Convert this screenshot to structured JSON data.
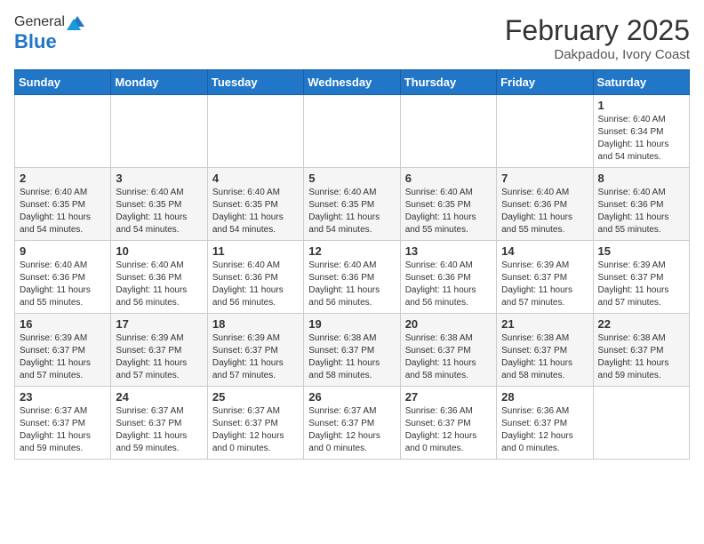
{
  "header": {
    "logo_general": "General",
    "logo_blue": "Blue",
    "month_title": "February 2025",
    "location": "Dakpadou, Ivory Coast"
  },
  "weekdays": [
    "Sunday",
    "Monday",
    "Tuesday",
    "Wednesday",
    "Thursday",
    "Friday",
    "Saturday"
  ],
  "weeks": [
    [
      {
        "day": "",
        "info": ""
      },
      {
        "day": "",
        "info": ""
      },
      {
        "day": "",
        "info": ""
      },
      {
        "day": "",
        "info": ""
      },
      {
        "day": "",
        "info": ""
      },
      {
        "day": "",
        "info": ""
      },
      {
        "day": "1",
        "info": "Sunrise: 6:40 AM\nSunset: 6:34 PM\nDaylight: 11 hours\nand 54 minutes."
      }
    ],
    [
      {
        "day": "2",
        "info": "Sunrise: 6:40 AM\nSunset: 6:35 PM\nDaylight: 11 hours\nand 54 minutes."
      },
      {
        "day": "3",
        "info": "Sunrise: 6:40 AM\nSunset: 6:35 PM\nDaylight: 11 hours\nand 54 minutes."
      },
      {
        "day": "4",
        "info": "Sunrise: 6:40 AM\nSunset: 6:35 PM\nDaylight: 11 hours\nand 54 minutes."
      },
      {
        "day": "5",
        "info": "Sunrise: 6:40 AM\nSunset: 6:35 PM\nDaylight: 11 hours\nand 54 minutes."
      },
      {
        "day": "6",
        "info": "Sunrise: 6:40 AM\nSunset: 6:35 PM\nDaylight: 11 hours\nand 55 minutes."
      },
      {
        "day": "7",
        "info": "Sunrise: 6:40 AM\nSunset: 6:36 PM\nDaylight: 11 hours\nand 55 minutes."
      },
      {
        "day": "8",
        "info": "Sunrise: 6:40 AM\nSunset: 6:36 PM\nDaylight: 11 hours\nand 55 minutes."
      }
    ],
    [
      {
        "day": "9",
        "info": "Sunrise: 6:40 AM\nSunset: 6:36 PM\nDaylight: 11 hours\nand 55 minutes."
      },
      {
        "day": "10",
        "info": "Sunrise: 6:40 AM\nSunset: 6:36 PM\nDaylight: 11 hours\nand 56 minutes."
      },
      {
        "day": "11",
        "info": "Sunrise: 6:40 AM\nSunset: 6:36 PM\nDaylight: 11 hours\nand 56 minutes."
      },
      {
        "day": "12",
        "info": "Sunrise: 6:40 AM\nSunset: 6:36 PM\nDaylight: 11 hours\nand 56 minutes."
      },
      {
        "day": "13",
        "info": "Sunrise: 6:40 AM\nSunset: 6:36 PM\nDaylight: 11 hours\nand 56 minutes."
      },
      {
        "day": "14",
        "info": "Sunrise: 6:39 AM\nSunset: 6:37 PM\nDaylight: 11 hours\nand 57 minutes."
      },
      {
        "day": "15",
        "info": "Sunrise: 6:39 AM\nSunset: 6:37 PM\nDaylight: 11 hours\nand 57 minutes."
      }
    ],
    [
      {
        "day": "16",
        "info": "Sunrise: 6:39 AM\nSunset: 6:37 PM\nDaylight: 11 hours\nand 57 minutes."
      },
      {
        "day": "17",
        "info": "Sunrise: 6:39 AM\nSunset: 6:37 PM\nDaylight: 11 hours\nand 57 minutes."
      },
      {
        "day": "18",
        "info": "Sunrise: 6:39 AM\nSunset: 6:37 PM\nDaylight: 11 hours\nand 57 minutes."
      },
      {
        "day": "19",
        "info": "Sunrise: 6:38 AM\nSunset: 6:37 PM\nDaylight: 11 hours\nand 58 minutes."
      },
      {
        "day": "20",
        "info": "Sunrise: 6:38 AM\nSunset: 6:37 PM\nDaylight: 11 hours\nand 58 minutes."
      },
      {
        "day": "21",
        "info": "Sunrise: 6:38 AM\nSunset: 6:37 PM\nDaylight: 11 hours\nand 58 minutes."
      },
      {
        "day": "22",
        "info": "Sunrise: 6:38 AM\nSunset: 6:37 PM\nDaylight: 11 hours\nand 59 minutes."
      }
    ],
    [
      {
        "day": "23",
        "info": "Sunrise: 6:37 AM\nSunset: 6:37 PM\nDaylight: 11 hours\nand 59 minutes."
      },
      {
        "day": "24",
        "info": "Sunrise: 6:37 AM\nSunset: 6:37 PM\nDaylight: 11 hours\nand 59 minutes."
      },
      {
        "day": "25",
        "info": "Sunrise: 6:37 AM\nSunset: 6:37 PM\nDaylight: 12 hours\nand 0 minutes."
      },
      {
        "day": "26",
        "info": "Sunrise: 6:37 AM\nSunset: 6:37 PM\nDaylight: 12 hours\nand 0 minutes."
      },
      {
        "day": "27",
        "info": "Sunrise: 6:36 AM\nSunset: 6:37 PM\nDaylight: 12 hours\nand 0 minutes."
      },
      {
        "day": "28",
        "info": "Sunrise: 6:36 AM\nSunset: 6:37 PM\nDaylight: 12 hours\nand 0 minutes."
      },
      {
        "day": "",
        "info": ""
      }
    ]
  ]
}
